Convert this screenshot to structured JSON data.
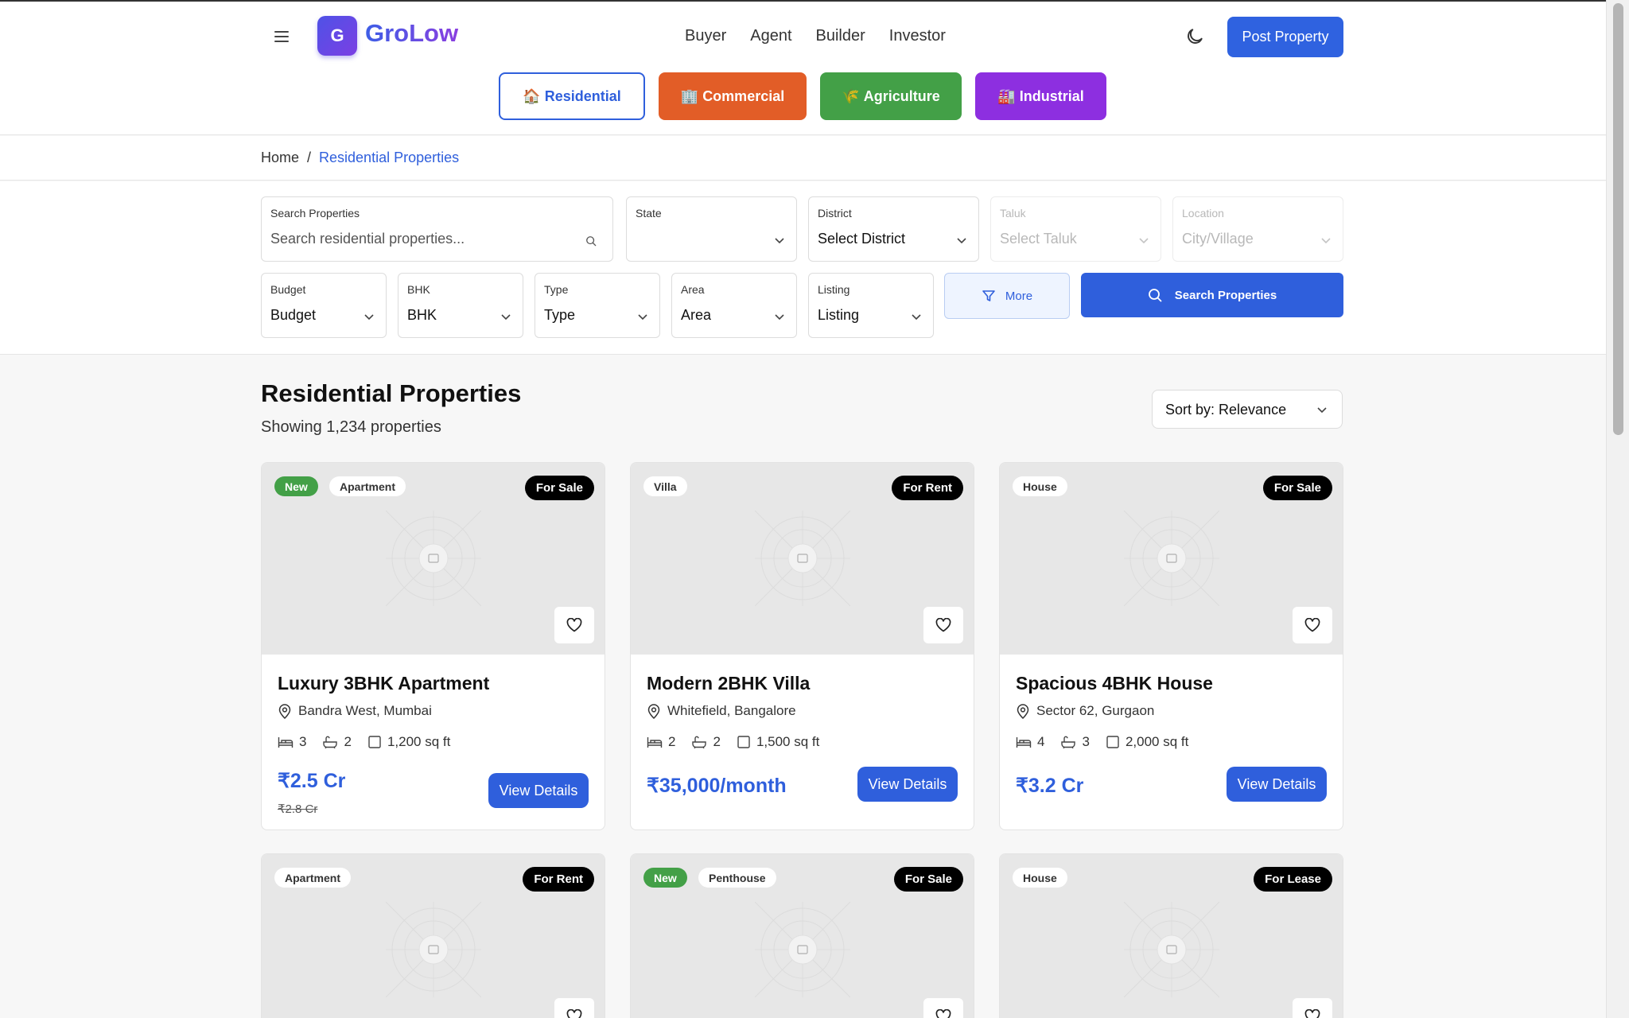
{
  "brand": {
    "logo_letter": "G",
    "name": "GroLow"
  },
  "nav": [
    "Buyer",
    "Agent",
    "Builder",
    "Investor"
  ],
  "header": {
    "post_label": "Post Property",
    "menu_icon": "hamburger-icon",
    "theme_icon": "moon-icon"
  },
  "categories": [
    {
      "icon": "🏠",
      "label": "Residential"
    },
    {
      "icon": "🏢",
      "label": "Commercial"
    },
    {
      "icon": "🌾",
      "label": "Agriculture"
    },
    {
      "icon": "🏭",
      "label": "Industrial"
    }
  ],
  "breadcrumb": {
    "home": "Home",
    "separator": "/",
    "current": "Residential Properties"
  },
  "filters": {
    "search": {
      "label": "Search Properties",
      "placeholder": "Search residential properties..."
    },
    "state": {
      "label": "State",
      "value": ""
    },
    "district": {
      "label": "District",
      "value": "Select District"
    },
    "taluk": {
      "label": "Taluk",
      "value": "Select Taluk"
    },
    "location": {
      "label": "Location",
      "value": "City/Village"
    },
    "budget": {
      "label": "Budget",
      "value": "Budget"
    },
    "bhk": {
      "label": "BHK",
      "value": "BHK"
    },
    "type": {
      "label": "Type",
      "value": "Type"
    },
    "area": {
      "label": "Area",
      "value": "Area"
    },
    "listing": {
      "label": "Listing",
      "value": "Listing"
    },
    "more_label": "More",
    "search_label": "Search Properties"
  },
  "listing": {
    "title": "Residential Properties",
    "count_text": "Showing 1,234 properties",
    "sort_label": "Sort by: Relevance",
    "view_label": "View Details"
  },
  "properties": [
    {
      "badge_new": "New",
      "type": "Apartment",
      "status": "For Sale",
      "title": "Luxury 3BHK Apartment",
      "location": "Bandra West, Mumbai",
      "beds": "3",
      "baths": "2",
      "area": "1,200 sq ft",
      "price": "₹2.5 Cr",
      "old_price": "₹2.8 Cr"
    },
    {
      "type": "Villa",
      "status": "For Rent",
      "title": "Modern 2BHK Villa",
      "location": "Whitefield, Bangalore",
      "beds": "2",
      "baths": "2",
      "area": "1,500 sq ft",
      "price": "₹35,000/month"
    },
    {
      "type": "House",
      "status": "For Sale",
      "title": "Spacious 4BHK House",
      "location": "Sector 62, Gurgaon",
      "beds": "4",
      "baths": "3",
      "area": "2,000 sq ft",
      "price": "₹3.2 Cr"
    },
    {
      "type": "Apartment",
      "status": "For Rent"
    },
    {
      "badge_new": "New",
      "type": "Penthouse",
      "status": "For Sale"
    },
    {
      "type": "House",
      "status": "For Lease"
    }
  ],
  "colors": {
    "primary": "#2f5fdc",
    "commercial": "#e25d27",
    "agriculture": "#43a047",
    "industrial": "#8d2fe0",
    "new_badge": "#43a047"
  }
}
